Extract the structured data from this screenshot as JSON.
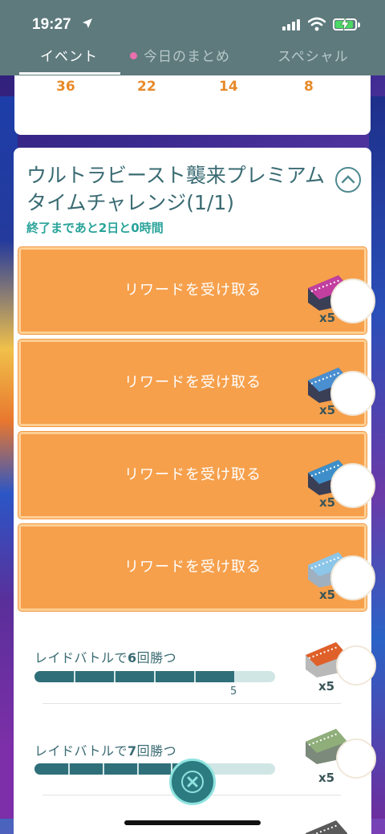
{
  "status_bar": {
    "time": "19:27"
  },
  "tabs": [
    {
      "label": "イベント",
      "active": true
    },
    {
      "label": "今日のまとめ",
      "active": false,
      "has_dot": true
    },
    {
      "label": "スペシャル",
      "active": false
    }
  ],
  "previous_card": {
    "counts": [
      "36",
      "22",
      "14",
      "8"
    ]
  },
  "challenge": {
    "title": "ウルトラビースト襲来プレミアムタイムチャレンジ(1/1)",
    "remaining": "終了まであと2日と0時間",
    "rewards": [
      {
        "button_label": "リワードを受け取る",
        "quantity": "x5",
        "ticket_color": "#c23fa0",
        "pokemon_icon": "pokemon-white-icon"
      },
      {
        "button_label": "リワードを受け取る",
        "quantity": "x5",
        "ticket_color": "#4a8fd0",
        "pokemon_icon": "pokemon-stone-icon"
      },
      {
        "button_label": "リワードを受け取る",
        "quantity": "x5",
        "ticket_color": "#3e8fc9",
        "pokemon_icon": "pokemon-dark-icon"
      },
      {
        "button_label": "リワードを受け取る",
        "quantity": "x5",
        "ticket_color": "#8cc6e8",
        "pokemon_icon": "pokemon-pale-icon"
      }
    ],
    "tasks": [
      {
        "label_prefix": "レイドバトルで",
        "label_number": "6",
        "label_suffix": "回勝つ",
        "progress": 5,
        "goal": 6,
        "progress_label": "5",
        "quantity": "x5",
        "ticket_color": "#e0602a",
        "pokemon_icon": "pokemon-yellow-icon"
      },
      {
        "label_prefix": "レイドバトルで",
        "label_number": "7",
        "label_suffix": "回勝つ",
        "progress": 5,
        "goal": 7,
        "quantity": "x5",
        "ticket_color": "#8fae7a",
        "pokemon_icon": "pokemon-green-icon"
      }
    ]
  }
}
